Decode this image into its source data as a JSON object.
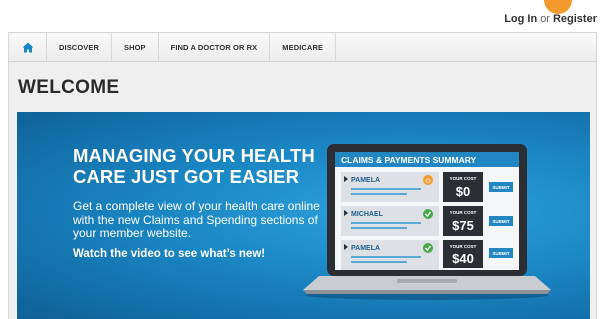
{
  "header": {
    "login_label": "Log In",
    "or_label": "or",
    "register_label": "Register"
  },
  "nav": {
    "items": [
      {
        "icon": "home-icon"
      },
      {
        "label": "DISCOVER"
      },
      {
        "label": "SHOP"
      },
      {
        "label": "FIND A DOCTOR OR RX"
      },
      {
        "label": "MEDICARE"
      }
    ]
  },
  "page": {
    "title": "WELCOME"
  },
  "hero": {
    "title_line1": "MANAGING YOUR HEALTH",
    "title_line2": "CARE JUST GOT EASIER",
    "text": "Get a complete view of your health care online with the new Claims and Spending sections of your member website.",
    "cta": "Watch the video to see what’s new!",
    "screen": {
      "header": "CLAIMS & PAYMENTS SUMMARY",
      "your_cost_label": "YOUR COST",
      "submit_label": "SUBMIT",
      "rows": [
        {
          "name": "PAMELA",
          "status": "pending",
          "cost": "$0"
        },
        {
          "name": "MICHAEL",
          "status": "approved",
          "cost": "$75"
        },
        {
          "name": "PAMELA",
          "status": "approved",
          "cost": "$40"
        }
      ]
    }
  },
  "colors": {
    "accent": "#f39a2c",
    "hero_blue": "#1a86c4",
    "nav_home_icon": "#1a86c4",
    "approved_green": "#4aa84a",
    "pending_orange": "#f39a2c"
  }
}
